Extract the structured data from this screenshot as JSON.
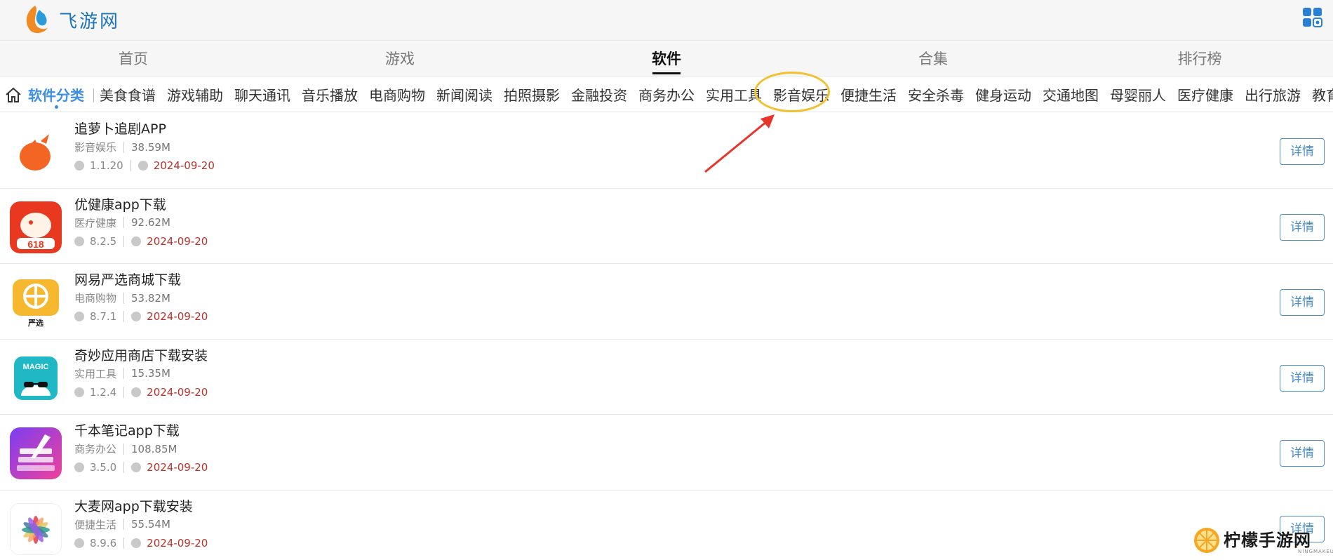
{
  "header": {
    "site_name": "飞游网",
    "logo_icon": "fire-water-logo-icon",
    "apps_icon": "grid-apps-icon"
  },
  "main_nav": {
    "items": [
      {
        "label": "首页",
        "active": false
      },
      {
        "label": "游戏",
        "active": false
      },
      {
        "label": "软件",
        "active": true
      },
      {
        "label": "合集",
        "active": false
      },
      {
        "label": "排行榜",
        "active": false
      }
    ]
  },
  "category_bar": {
    "home_icon": "home-icon",
    "title": "软件分类",
    "items": [
      "美食食谱",
      "游戏辅助",
      "聊天通讯",
      "音乐播放",
      "电商购物",
      "新闻阅读",
      "拍照摄影",
      "金融投资",
      "商务办公",
      "实用工具",
      "影音娱乐",
      "便捷生活",
      "安全杀毒",
      "健身运动",
      "交通地图",
      "母婴丽人",
      "医疗健康",
      "出行旅游",
      "教育学"
    ],
    "highlighted": "影音娱乐",
    "highlight_color": "#f2c12e",
    "arrow_color": "#e8342a"
  },
  "apps": [
    {
      "name": "追萝卜追剧APP",
      "category": "影音娱乐",
      "size": "38.59M",
      "version": "1.1.20",
      "date": "2024-09-20",
      "detail_label": "详情",
      "icon": "carrot-icon"
    },
    {
      "name": "优健康app下载",
      "category": "医疗健康",
      "size": "92.62M",
      "version": "8.2.5",
      "date": "2024-09-20",
      "detail_label": "详情",
      "icon": "whale-618-icon"
    },
    {
      "name": "网易严选商城下载",
      "category": "电商购物",
      "size": "53.82M",
      "version": "8.7.1",
      "date": "2024-09-20",
      "detail_label": "详情",
      "icon": "yanxuan-icon"
    },
    {
      "name": "奇妙应用商店下载安装",
      "category": "实用工具",
      "size": "15.35M",
      "version": "1.2.4",
      "date": "2024-09-20",
      "detail_label": "详情",
      "icon": "magic-android-icon"
    },
    {
      "name": "千本笔记app下载",
      "category": "商务办公",
      "size": "108.85M",
      "version": "3.5.0",
      "date": "2024-09-20",
      "detail_label": "详情",
      "icon": "notebook-pen-icon"
    },
    {
      "name": "大麦网app下载安装",
      "category": "便捷生活",
      "size": "55.54M",
      "version": "8.9.6",
      "date": "2024-09-20",
      "detail_label": "详情",
      "icon": "damai-flower-icon"
    }
  ],
  "watermark": {
    "text": "柠檬手游网",
    "sub": "NINGMAKEUP.COM",
    "icon": "lemon-slice-icon"
  },
  "colors": {
    "accent_blue": "#3d8fe6",
    "date_red": "#b5322b",
    "button_blue": "#4a8fc9"
  }
}
